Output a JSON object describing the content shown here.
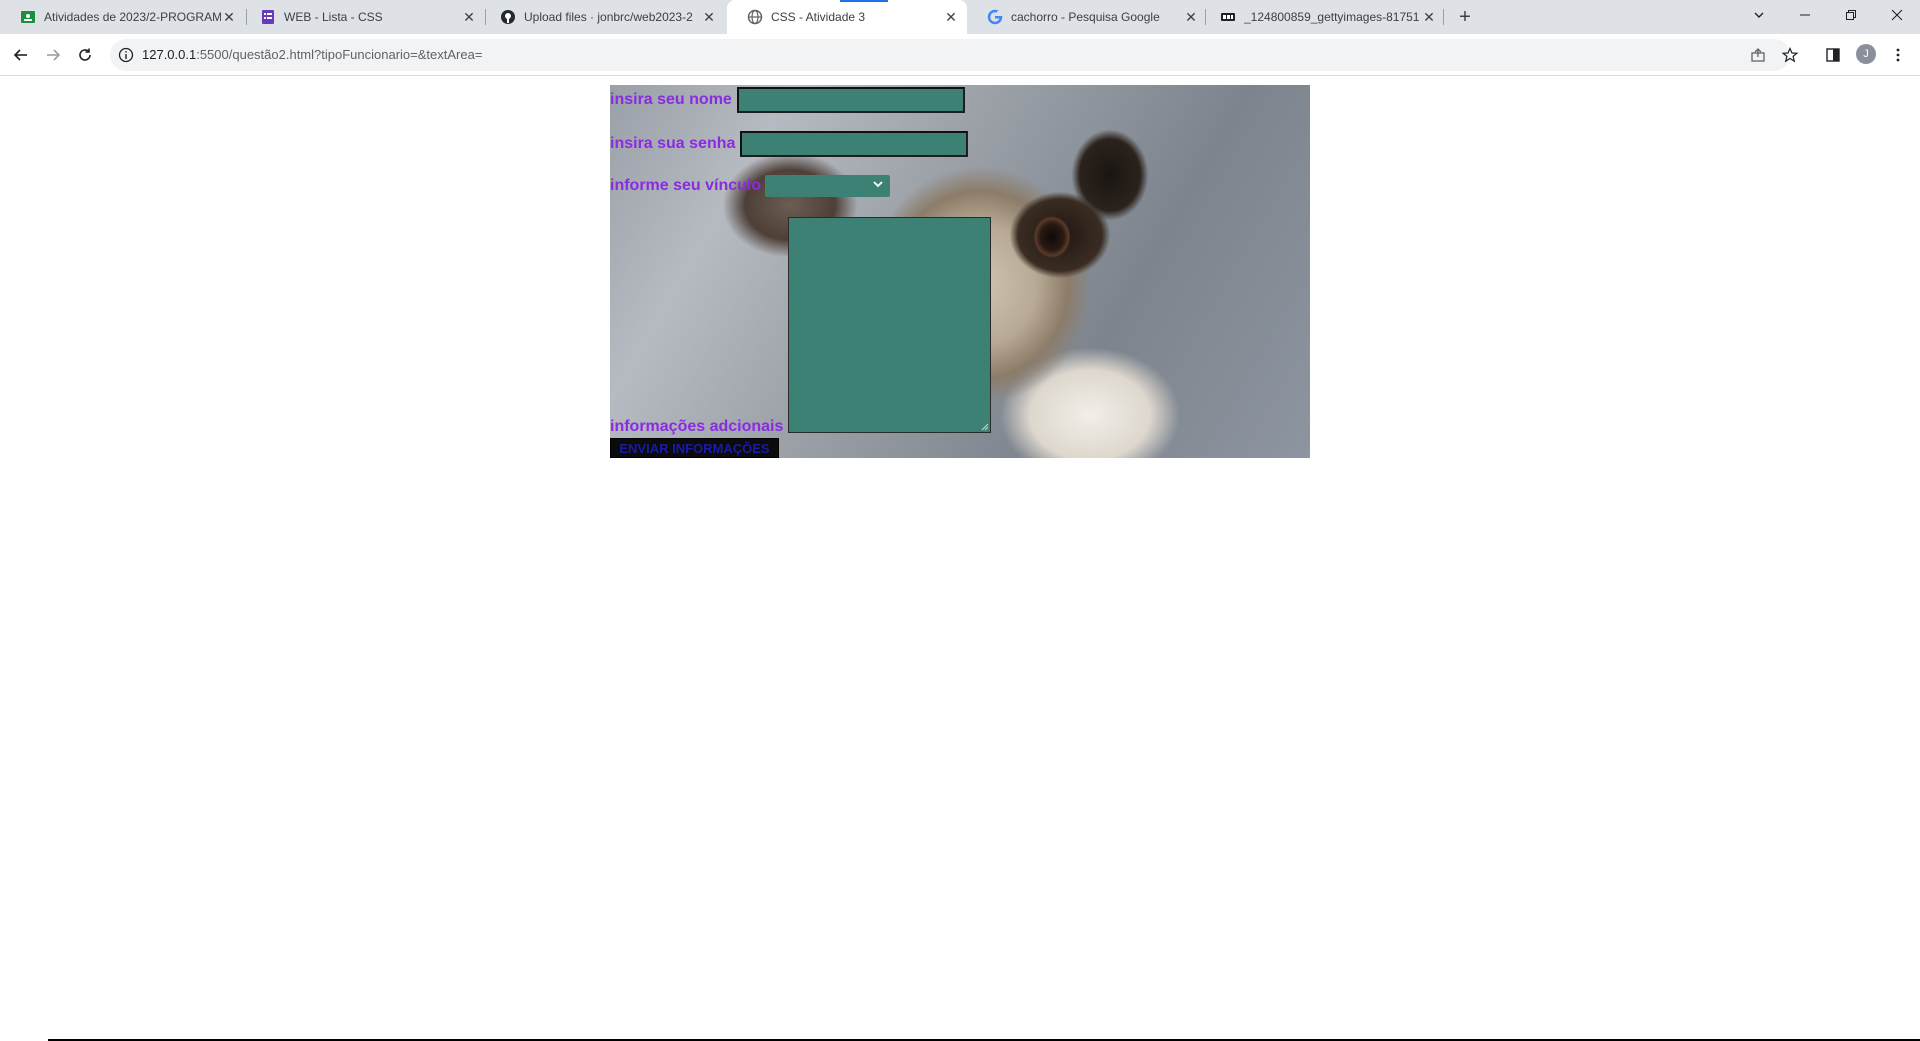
{
  "browser": {
    "tabs": [
      {
        "title": "Atividades de 2023/2-PROGRAM",
        "icon": "classroom-icon",
        "color": "#1e8e3e"
      },
      {
        "title": "WEB - Lista - CSS",
        "icon": "forms-icon",
        "color": "#673ab7"
      },
      {
        "title": "Upload files · jonbrc/web2023-2",
        "icon": "github-icon",
        "color": "#24292f"
      },
      {
        "title": "CSS - Atividade 3",
        "icon": "globe-icon",
        "color": "#5f6368"
      },
      {
        "title": "cachorro - Pesquisa Google",
        "icon": "google-icon",
        "color": "#4285f4"
      },
      {
        "title": "_124800859_gettyimages-81751",
        "icon": "image-icon",
        "color": "#202124"
      }
    ],
    "close_glyph": "✕",
    "new_tab_glyph": "+",
    "url_host": "127.0.0.1",
    "url_rest": ":5500/questão2.html?tipoFuncionario=&textArea=",
    "avatar_letter": "J"
  },
  "form": {
    "name_label": "insira seu nome",
    "password_label": "insira sua senha",
    "role_label": "informe seu vínculo",
    "info_label": "informações adcionais",
    "submit_label": "ENVIAR INFORMAÇÕES",
    "label_color": "#8a2be2",
    "field_color": "#3d8174"
  }
}
